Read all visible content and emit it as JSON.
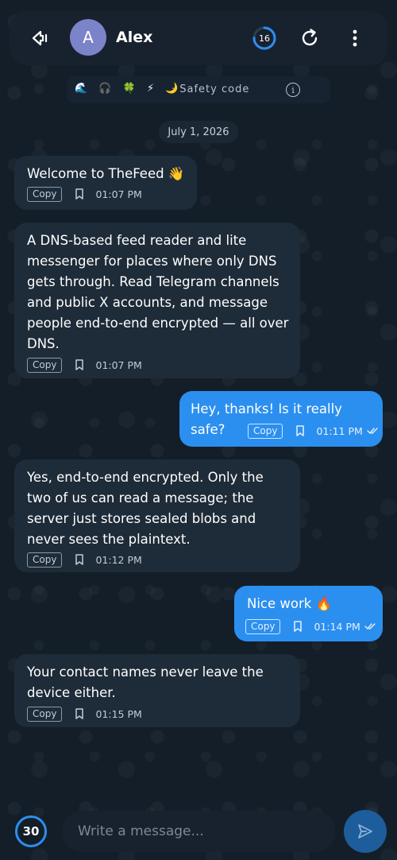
{
  "header": {
    "avatar_letter": "A",
    "contact_name": "Alex",
    "counter": "16",
    "counter_progress": 0.75
  },
  "safety": {
    "emojis": "🌊 🎧 🍀 ⚡ 🌙",
    "label": "· Safety code",
    "info_glyph": "i"
  },
  "date_separator": "July 1, 2026",
  "messages": [
    {
      "direction": "in",
      "text": "Welcome to TheFeed 👋",
      "copy": "Copy",
      "time": "01:07 PM"
    },
    {
      "direction": "in",
      "text": "A DNS-based feed reader and lite messenger for places where only DNS gets through. Read Telegram channels and public X accounts, and message people end-to-end encrypted — all over DNS.",
      "copy": "Copy",
      "time": "01:07 PM"
    },
    {
      "direction": "out",
      "text": "Hey, thanks! Is it really safe?",
      "copy": "Copy",
      "time": "01:11 PM"
    },
    {
      "direction": "in",
      "text": "Yes, end-to-end encrypted. Only the two of us can read a message; the server just stores sealed blobs and never sees the plaintext.",
      "copy": "Copy",
      "time": "01:12 PM"
    },
    {
      "direction": "out",
      "text": "Nice work 🔥",
      "copy": "Copy",
      "time": "01:14 PM"
    },
    {
      "direction": "in",
      "text": "Your contact names never leave the device either.",
      "copy": "Copy",
      "time": "01:15 PM"
    }
  ],
  "composer": {
    "counter": "30",
    "placeholder": "Write a message..."
  },
  "colors": {
    "background": "#141e28",
    "incoming_bubble": "#1e2b38",
    "outgoing_bubble": "#2b8ff0",
    "accent": "#2b8ff0",
    "avatar": "#7b83c9"
  }
}
